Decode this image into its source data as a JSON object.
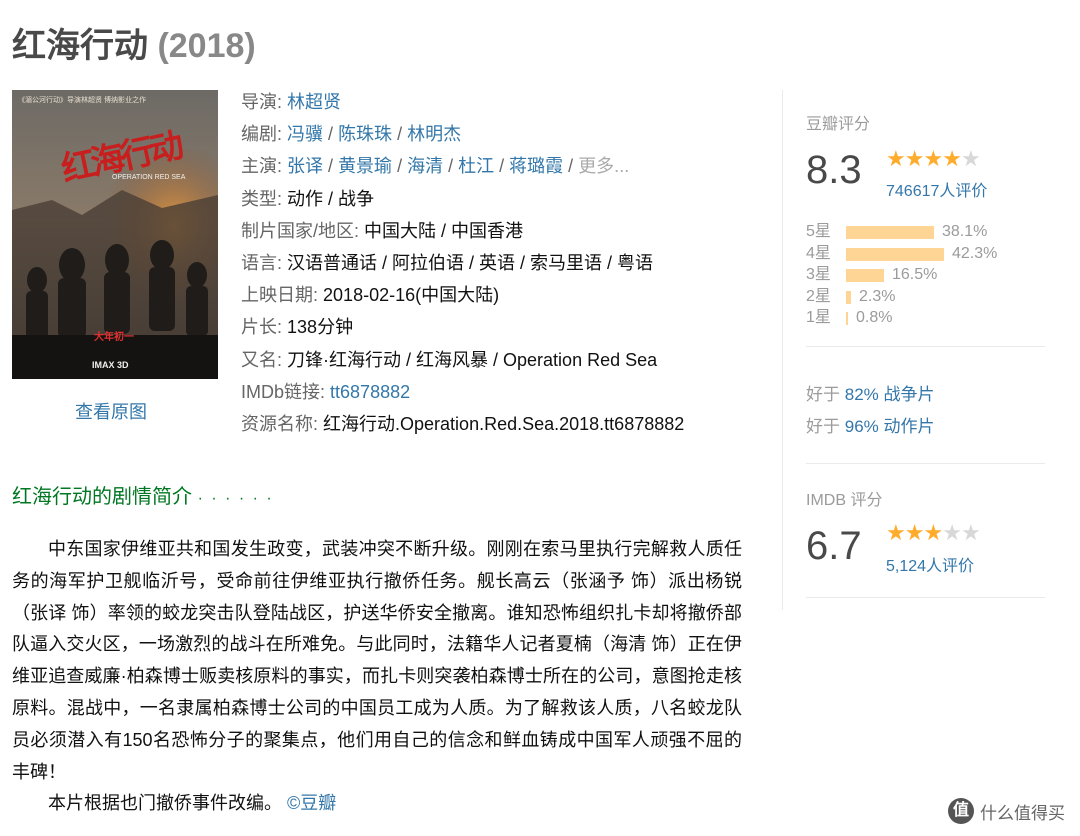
{
  "movie": {
    "title": "红海行动",
    "year": "(2018)"
  },
  "poster": {
    "top_text": "《湄公河行动》导演林超贤 博纳影业之作",
    "title_cn": "红海行动",
    "title_en": "OPERATION RED SEA",
    "release_text": "大年初一",
    "imax_text": "IMAX 3D",
    "view_original": "查看原图"
  },
  "info": {
    "director_label": "导演:",
    "director": "林超贤",
    "writers_label": "编剧:",
    "writers": [
      "冯骥",
      "陈珠珠",
      "林明杰"
    ],
    "cast_label": "主演:",
    "cast": [
      "张译",
      "黄景瑜",
      "海清",
      "杜江",
      "蒋璐霞"
    ],
    "cast_more": "更多...",
    "genre_label": "类型:",
    "genre": "动作 / 战争",
    "country_label": "制片国家/地区:",
    "country": "中国大陆 / 中国香港",
    "language_label": "语言:",
    "language": "汉语普通话 / 阿拉伯语 / 英语 / 索马里语 / 粤语",
    "release_label": "上映日期:",
    "release": "2018-02-16(中国大陆)",
    "runtime_label": "片长:",
    "runtime": "138分钟",
    "aka_label": "又名:",
    "aka": "刀锋·红海行动 / 红海风暴 / Operation Red Sea",
    "imdb_label": "IMDb链接:",
    "imdb_link": "tt6878882",
    "resource_label": "资源名称:",
    "resource": "红海行动.Operation.Red.Sea.2018.tt6878882"
  },
  "douban": {
    "label": "豆瓣评分",
    "score": "8.3",
    "stars_filled": 4,
    "votes": "746617人评价",
    "distribution": [
      {
        "label": "5星",
        "percent": 38.1,
        "text": "38.1%"
      },
      {
        "label": "4星",
        "percent": 42.3,
        "text": "42.3%"
      },
      {
        "label": "3星",
        "percent": 16.5,
        "text": "16.5%"
      },
      {
        "label": "2星",
        "percent": 2.3,
        "text": "2.3%"
      },
      {
        "label": "1星",
        "percent": 0.8,
        "text": "0.8%"
      }
    ],
    "better_than": [
      {
        "prefix": "好于",
        "value": "82%",
        "category": "战争片"
      },
      {
        "prefix": "好于",
        "value": "96%",
        "category": "动作片"
      }
    ]
  },
  "imdb": {
    "label": "IMDB 评分",
    "score": "6.7",
    "stars_filled": 3,
    "votes": "5,124人评价"
  },
  "summary": {
    "heading": "红海行动的剧情简介",
    "dots": "· · · · · ·",
    "paragraph": "中东国家伊维亚共和国发生政变，武装冲突不断升级。刚刚在索马里执行完解救人质任务的海军护卫舰临沂号，受命前往伊维亚执行撤侨任务。舰长高云（张涵予 饰）派出杨锐（张译 饰）率领的蛟龙突击队登陆战区，护送华侨安全撤离。谁知恐怖组织扎卡却将撤侨部队逼入交火区，一场激烈的战斗在所难免。与此同时，法籍华人记者夏楠（海清 饰）正在伊维亚追查威廉·柏森博士贩卖核原料的事实，而扎卡则突袭柏森博士所在的公司，意图抢走核原料。混战中，一名隶属柏森博士公司的中国员工成为人质。为了解救该人质，八名蛟龙队员必须潜入有150名恐怖分子的聚集点，他们用自己的信念和鲜血铸成中国军人顽强不屈的丰碑！",
    "note": "本片根据也门撤侨事件改编。",
    "source": "©豆瓣"
  },
  "watermark": {
    "badge": "值",
    "text": "什么值得买"
  }
}
